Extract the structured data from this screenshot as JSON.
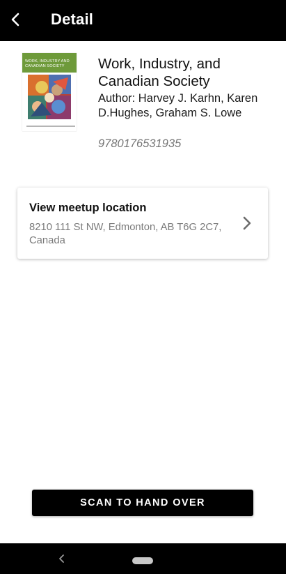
{
  "app_bar": {
    "title": "Detail",
    "back_icon": "chevron-left-icon"
  },
  "book": {
    "title": "Work, Industry, and Canadian Society",
    "author": "Author: Harvey J. Karhn, Karen D.Hughes, Graham S. Lowe",
    "isbn": "9780176531935",
    "cover_text": "WORK, INDUSTRY AND CANADIAN SOCIETY",
    "cover_color": "#6e9a3a"
  },
  "meetup": {
    "heading": "View meetup location",
    "address": "8210 111 St NW, Edmonton, AB T6G 2C7, Canada",
    "icon": "chevron-right-icon"
  },
  "actions": {
    "scan_label": "SCAN TO HAND OVER"
  },
  "system_nav": {
    "back_icon": "nav-back-icon",
    "home_icon": "home-pill-icon"
  }
}
